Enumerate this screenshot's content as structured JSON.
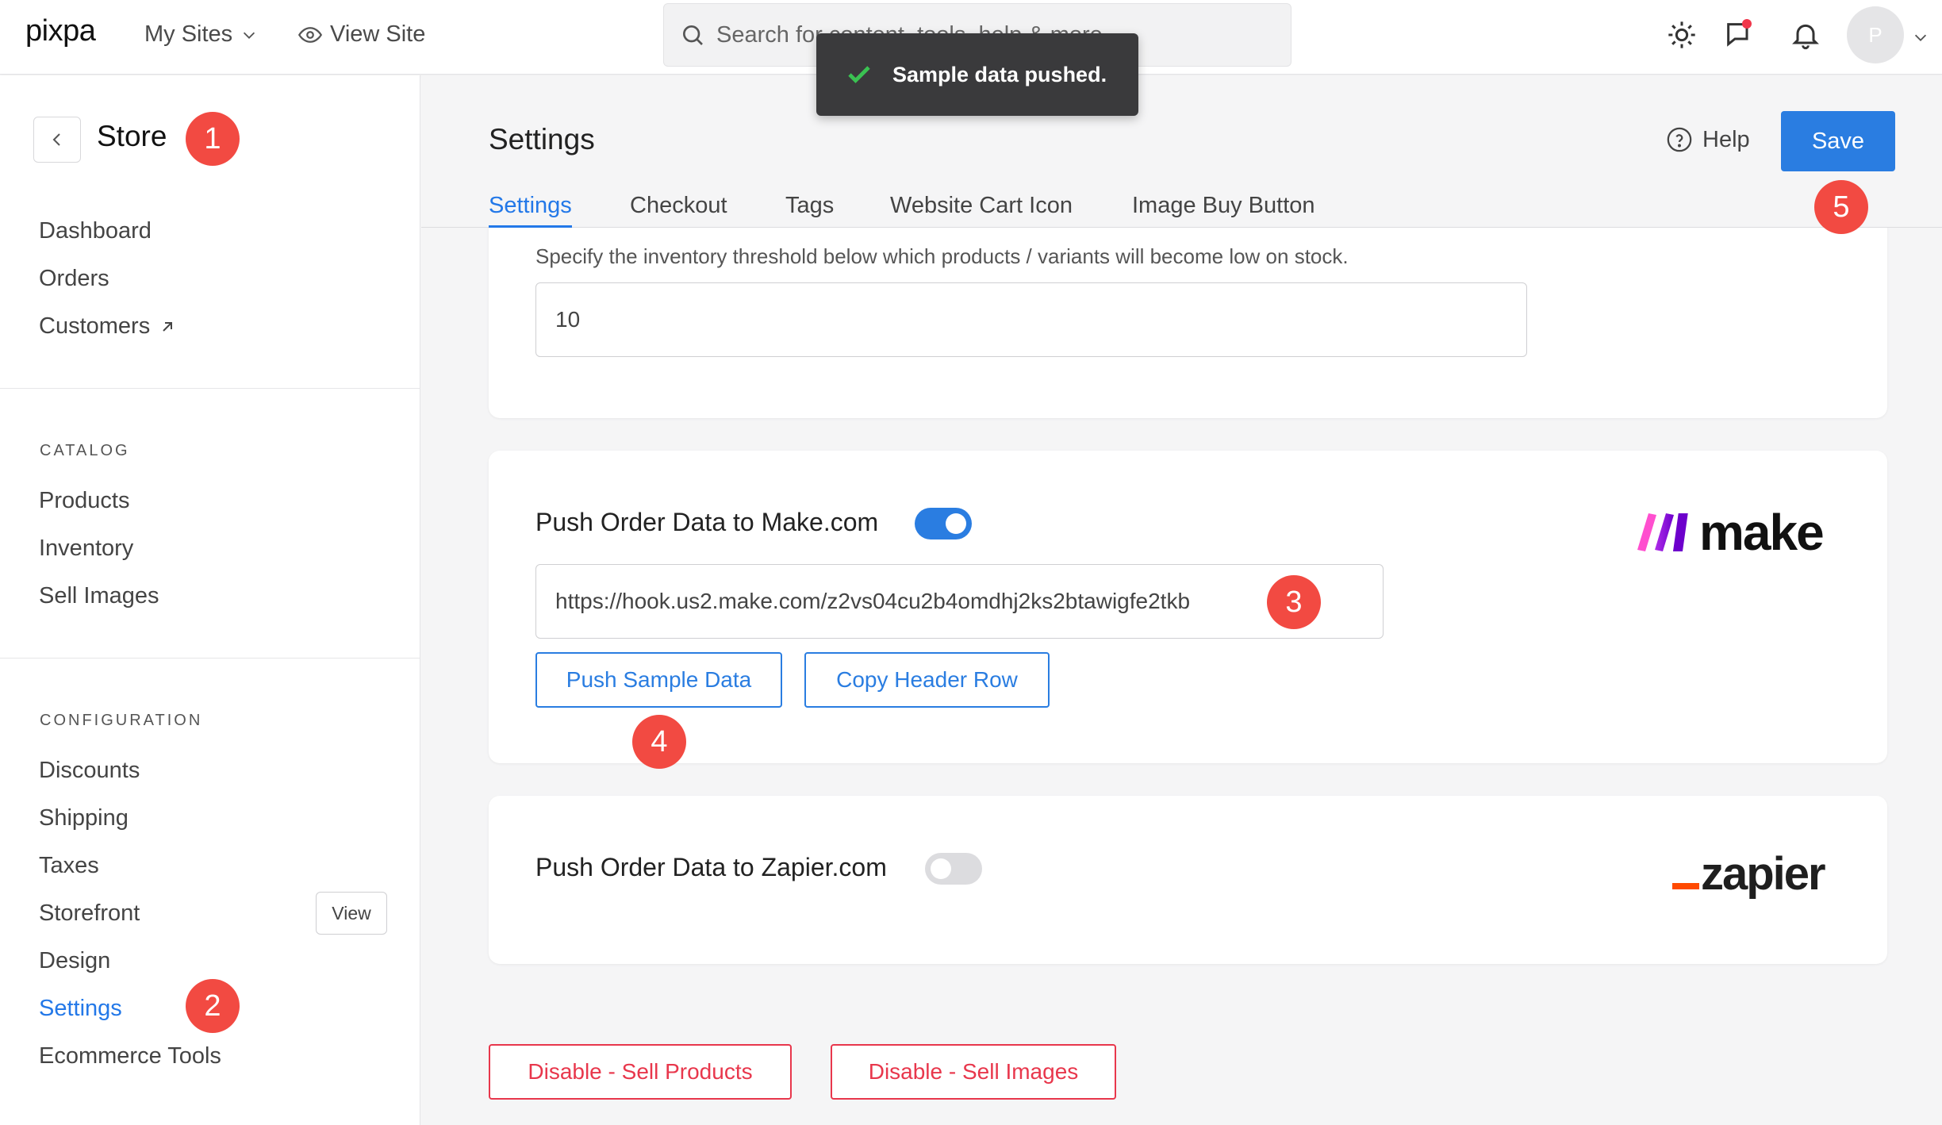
{
  "topbar": {
    "logo": "pixpa",
    "my_sites": "My Sites",
    "view_site": "View Site",
    "search_placeholder": "Search for content, tools, help & more",
    "avatar_initial": "P"
  },
  "toast": {
    "message": "Sample data pushed."
  },
  "sidebar": {
    "title": "Store",
    "top_items": [
      {
        "label": "Dashboard"
      },
      {
        "label": "Orders"
      },
      {
        "label": "Customers"
      }
    ],
    "catalog_label": "CATALOG",
    "catalog_items": [
      {
        "label": "Products"
      },
      {
        "label": "Inventory"
      },
      {
        "label": "Sell Images"
      }
    ],
    "configuration_label": "CONFIGURATION",
    "configuration_items": [
      {
        "label": "Discounts"
      },
      {
        "label": "Shipping"
      },
      {
        "label": "Taxes"
      },
      {
        "label": "Storefront"
      },
      {
        "label": "Design"
      },
      {
        "label": "Settings",
        "active": true
      },
      {
        "label": "Ecommerce Tools"
      }
    ],
    "view_button": "View"
  },
  "main": {
    "title": "Settings",
    "help": "Help",
    "save": "Save",
    "tabs": [
      {
        "label": "Settings",
        "active": true
      },
      {
        "label": "Checkout"
      },
      {
        "label": "Tags"
      },
      {
        "label": "Website Cart Icon"
      },
      {
        "label": "Image Buy Button"
      }
    ],
    "inventory": {
      "hint": "Specify the inventory threshold below which products / variants will become low on stock.",
      "threshold": "10"
    },
    "make": {
      "title": "Push Order Data to Make.com",
      "enabled": true,
      "webhook_url": "https://hook.us2.make.com/z2vs04cu2b4omdhj2ks2btawigfe2tkb",
      "push_sample": "Push Sample Data",
      "copy_header": "Copy Header Row",
      "logo_text": "make"
    },
    "zapier": {
      "title": "Push Order Data to Zapier.com",
      "enabled": false,
      "logo_text": "zapier"
    },
    "disable_products": "Disable - Sell Products",
    "disable_images": "Disable - Sell Images"
  },
  "markers": [
    "1",
    "2",
    "3",
    "4",
    "5"
  ],
  "colors": {
    "accent": "#2a7de1",
    "danger": "#e8374c",
    "marker": "#f24a42",
    "toast_bg": "#3a3a3c"
  }
}
